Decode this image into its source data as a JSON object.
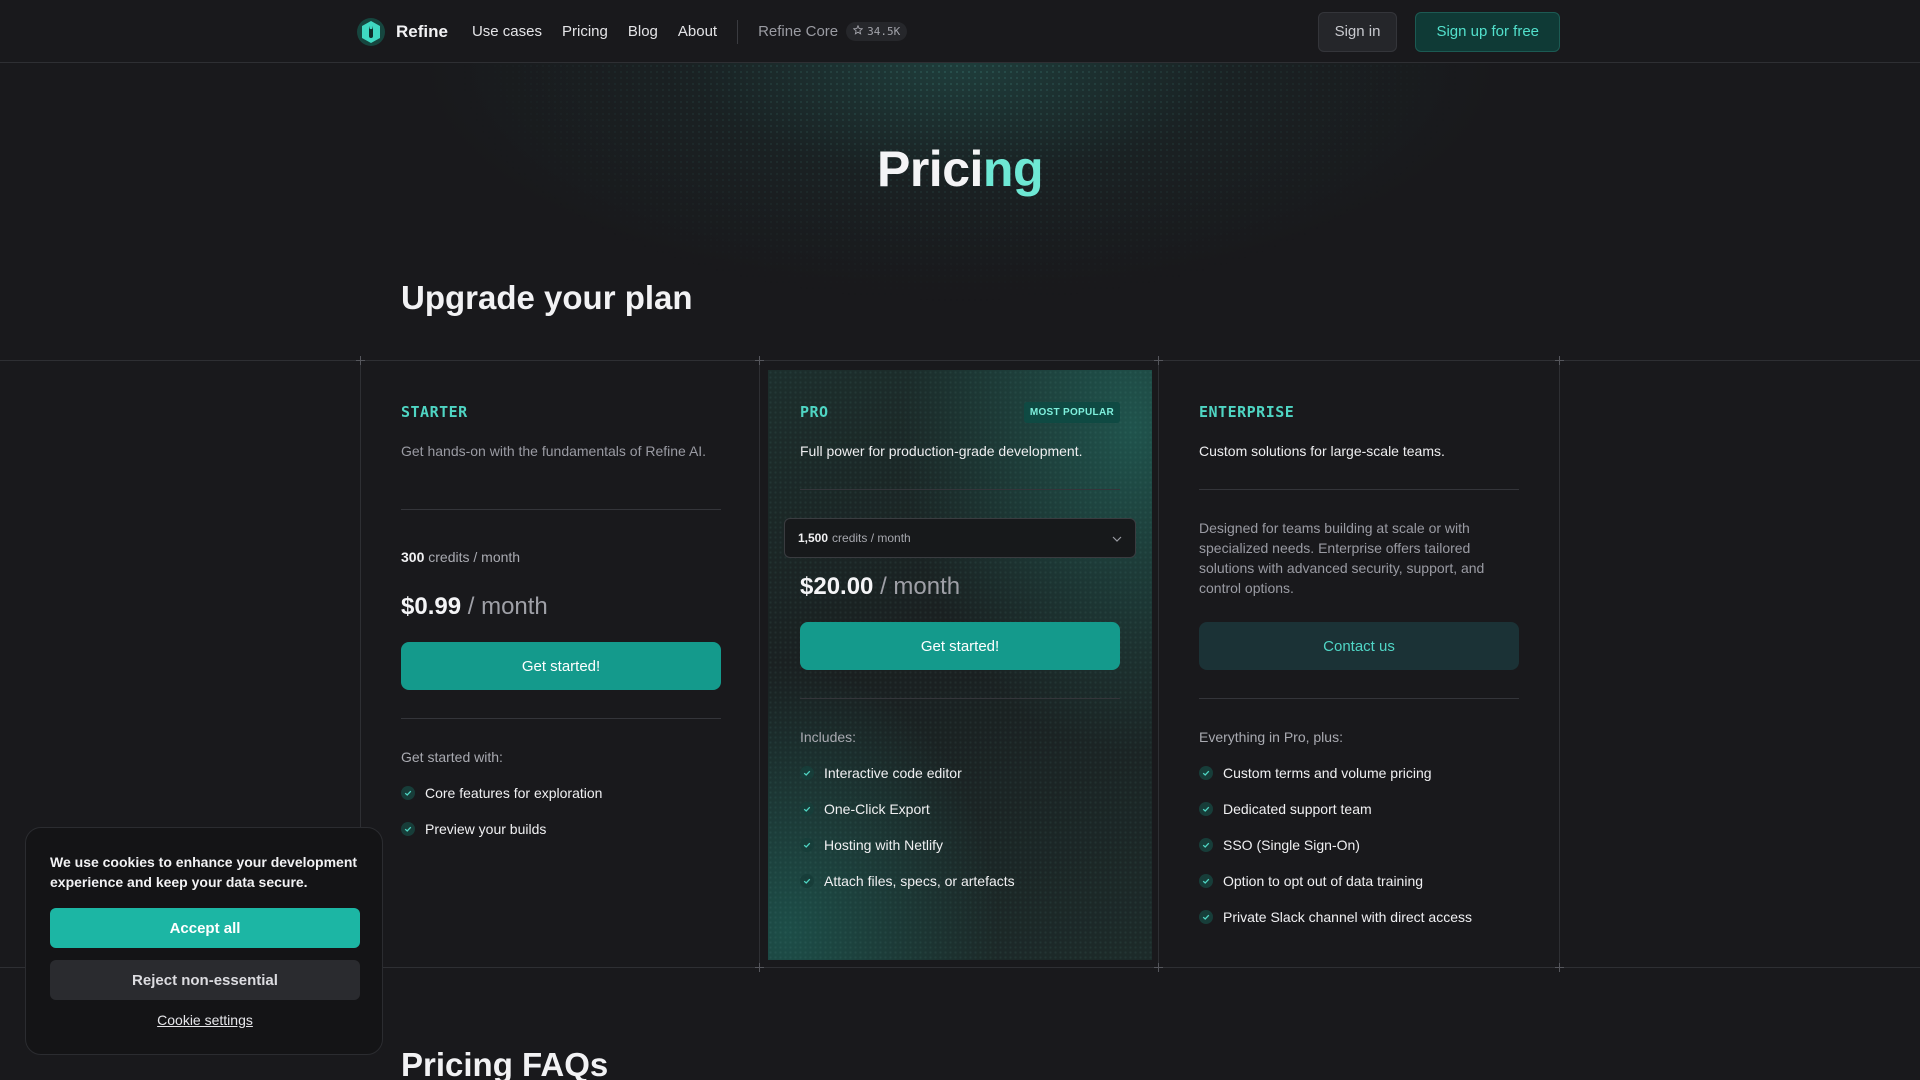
{
  "nav": {
    "brand": "Refine",
    "links": [
      "Use cases",
      "Pricing",
      "Blog",
      "About"
    ],
    "core_label": "Refine Core",
    "stars": "34.5K",
    "signin": "Sign in",
    "signup": "Sign up for free"
  },
  "hero": {
    "title_main": "Prici",
    "title_accent": "ng",
    "subtitle": "Upgrade your plan"
  },
  "plans": {
    "starter": {
      "name": "STARTER",
      "desc": "Get hands-on with the fundamentals of Refine AI.",
      "credits_amount": "300",
      "credits_unit": "credits / month",
      "price": "$0.99",
      "per": "/ month",
      "cta": "Get started!",
      "features_head": "Get started with:",
      "features": [
        "Core features for exploration",
        "Preview your builds"
      ]
    },
    "pro": {
      "name": "PRO",
      "badge": "MOST POPULAR",
      "desc": "Full power for production-grade development.",
      "credits_amount": "1,500",
      "credits_unit": "credits / month",
      "price": "$20.00",
      "per": "/ month",
      "cta": "Get started!",
      "features_head": "Includes:",
      "features": [
        "Interactive code editor",
        "One-Click Export",
        "Hosting with Netlify",
        "Attach files, specs, or artefacts"
      ]
    },
    "enterprise": {
      "name": "ENTERPRISE",
      "desc": "Custom solutions for large-scale teams.",
      "details": "Designed for teams building at scale or with specialized needs. Enterprise offers tailored solutions with advanced security, support, and control options.",
      "cta": "Contact us",
      "features_head": "Everything in Pro, plus:",
      "features": [
        "Custom terms and volume pricing",
        "Dedicated support team",
        "SSO (Single Sign-On)",
        "Option to opt out of data training",
        "Private Slack channel with direct access"
      ]
    }
  },
  "faq": {
    "title": "Pricing FAQs"
  },
  "cookie": {
    "message": "We use cookies to enhance your development experience and keep your data secure.",
    "accept": "Accept all",
    "reject": "Reject non-essential",
    "settings": "Cookie settings"
  },
  "colors": {
    "background": "#19191c",
    "accent": "#149a8c",
    "accent_text": "#4fd5c3",
    "accept_button": "#1cb6a4"
  },
  "icons": {
    "logo": "refine-logo-icon",
    "star": "github-star-icon",
    "check": "check-circle-icon",
    "dropdown": "chevron-down-icon"
  }
}
